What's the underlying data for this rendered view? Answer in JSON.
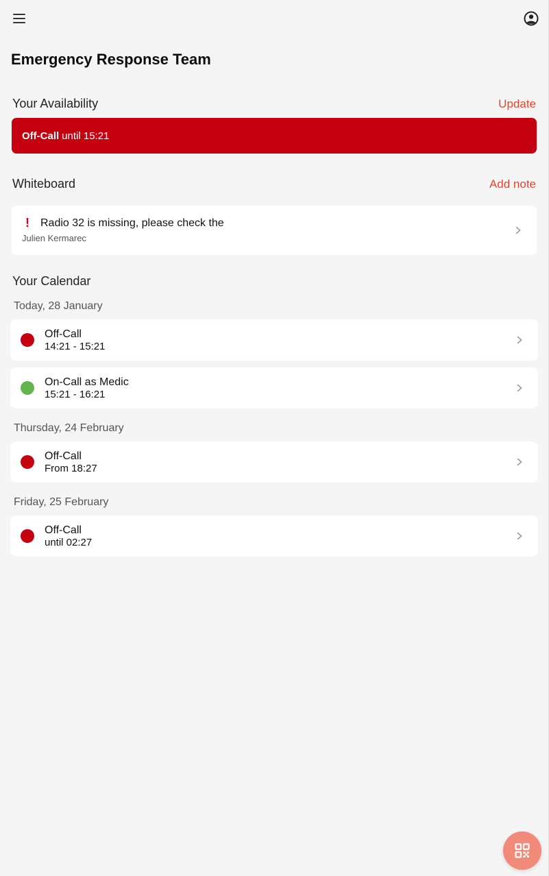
{
  "header": {
    "menu_icon": "hamburger-menu-icon",
    "profile_icon": "account-circle-icon",
    "title": "Emergency Response Team"
  },
  "availability": {
    "section_title": "Your Availability",
    "action_label": "Update",
    "status": "Off-Call",
    "detail": "until 15:21",
    "color": "#c5000f"
  },
  "whiteboard": {
    "section_title": "Whiteboard",
    "action_label": "Add note",
    "notes": [
      {
        "icon": "!",
        "title": "Radio 32 is missing, please check the",
        "author": "Julien Kermarec"
      }
    ]
  },
  "calendar": {
    "section_title": "Your Calendar",
    "groups": [
      {
        "date": "Today, 28 January",
        "events": [
          {
            "title": "Off-Call",
            "time": "14:21 - 15:21",
            "color": "#c5000f"
          },
          {
            "title": "On-Call as Medic",
            "time": "15:21 - 16:21",
            "color": "#64b450"
          }
        ]
      },
      {
        "date": "Thursday, 24 February",
        "events": [
          {
            "title": "Off-Call",
            "time": "From 18:27",
            "color": "#c5000f"
          }
        ]
      },
      {
        "date": "Friday, 25 February",
        "events": [
          {
            "title": "Off-Call",
            "time": "until 02:27",
            "color": "#c5000f"
          }
        ]
      }
    ]
  },
  "fab": {
    "icon": "qr-code-scan-icon",
    "color": "#f28a7a"
  },
  "colors": {
    "accent": "#e5452f",
    "background": "#f5f5f5"
  }
}
